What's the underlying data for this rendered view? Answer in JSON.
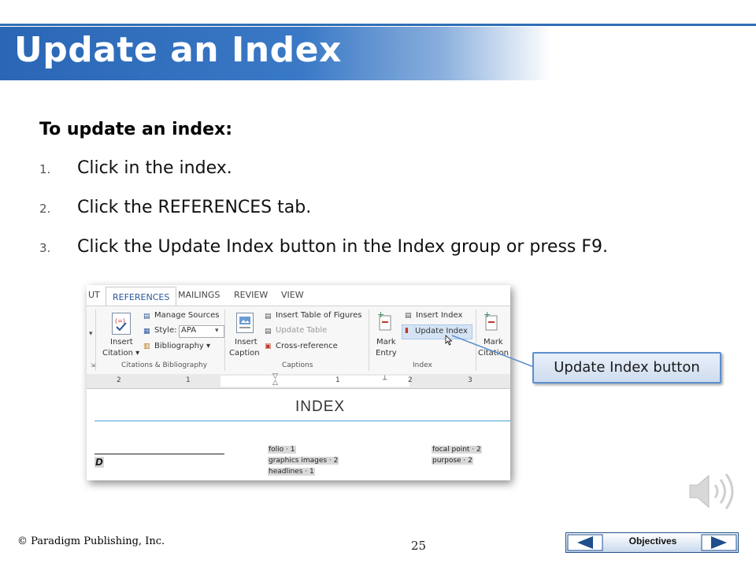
{
  "slide": {
    "title": "Update an Index",
    "heading": "To update an index:",
    "steps": [
      {
        "num": "1.",
        "text": "Click in the index."
      },
      {
        "num": "2.",
        "text": "Click the REFERENCES tab."
      },
      {
        "num": "3.",
        "text": "Click the Update Index button in the Index group or press F9."
      }
    ],
    "callout": "Update Index button",
    "copyright": "© Paradigm Publishing, Inc.",
    "page_number": "25",
    "nav": {
      "label": "Objectives"
    }
  },
  "screenshot": {
    "tabs": [
      "UT",
      "REFERENCES",
      "MAILINGS",
      "REVIEW",
      "VIEW"
    ],
    "active_tab": "REFERENCES",
    "ribbon": {
      "insert_citation": [
        "Insert",
        "Citation ▾"
      ],
      "manage_sources": "Manage Sources",
      "style_label": "Style:",
      "style_value": "APA",
      "bibliography": "Bibliography ▾",
      "group_citations": "Citations & Bibliography",
      "insert_caption": [
        "Insert",
        "Caption"
      ],
      "insert_table_of_figures": "Insert Table of Figures",
      "update_table": "Update Table",
      "cross_reference": "Cross-reference",
      "group_captions": "Captions",
      "mark_entry": [
        "Mark",
        "Entry"
      ],
      "insert_index": "Insert Index",
      "update_index": "Update Index",
      "group_index": "Index",
      "mark_citation": [
        "Mark",
        "Citation"
      ]
    },
    "ruler": [
      "2",
      "1",
      "1",
      "2",
      "3"
    ],
    "document": {
      "heading": "INDEX",
      "letter": "D",
      "col1": [
        "folio · 1",
        "graphics images · 2",
        "headlines · 1"
      ],
      "col2": [
        "focal point · 2",
        "purpose · 2"
      ]
    }
  },
  "colors": {
    "title_bar": "#2a66b5",
    "accent_line": "#2f6fb5",
    "callout_border": "#5b8fcf",
    "index_rule": "#4aa3d8"
  }
}
